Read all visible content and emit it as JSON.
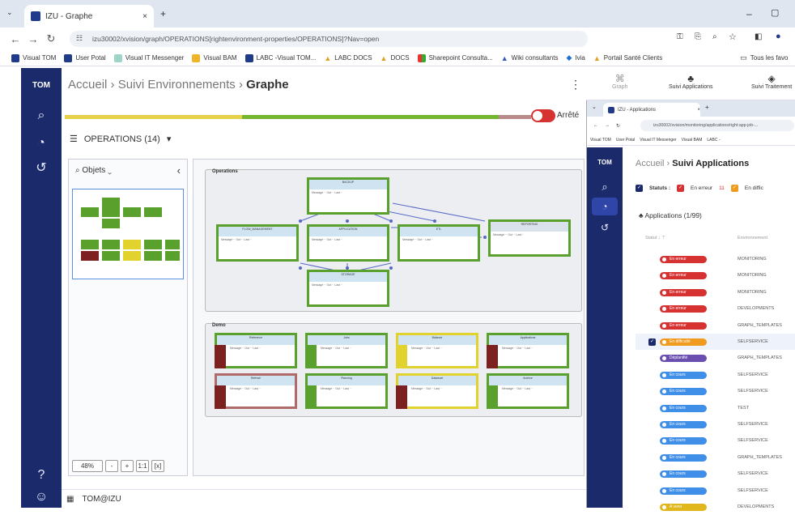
{
  "browser": {
    "tab_title": "IZU - Graphe",
    "tab_close": "×",
    "new_tab": "+",
    "url": "izu30002/xvision/graph/OPERATIONS[rightenvironment-properties/OPERATIONS]?Nav=open",
    "bookmarks": [
      "Visual TOM",
      "User Potal",
      "Visual IT Messenger",
      "Visual BAM",
      "LABC -Visual TOM...",
      "LABC DOCS",
      "DOCS",
      "Sharepoint Consulta...",
      "Wiki consultants",
      "Ivia",
      "Portail Santé Clients",
      "Tous les favo"
    ],
    "window_controls": [
      "–",
      "▢"
    ]
  },
  "app": {
    "logo": "TOM",
    "breadcrumb": {
      "home": "Accueil",
      "mid": "Suivi Environnements",
      "current": "Graphe"
    },
    "kebab": "⋮",
    "toggle_label": "Arrêté",
    "progress": {
      "yellow_fraction": 0.38
    },
    "operations_label": "OPERATIONS (14)",
    "objects_label": "Objets",
    "zoom_value": "48%",
    "zoom_buttons": [
      "-",
      "+",
      "1:1",
      "[x]"
    ],
    "user": "TOM@IZU",
    "group_operations": "Operations",
    "group_demo": "Demo",
    "colors": {
      "sidebar": "#1b2a6b",
      "green": "#5aa02c",
      "brown": "#7c2020",
      "yellow": "#e2d22d",
      "accent": "#74b72e"
    }
  },
  "top_apps": [
    "Graph",
    "Suivi Applications",
    "Suivi Traitement"
  ],
  "app2": {
    "tab_title": "IZU - Applications",
    "url": "izu30002/xvision/monitoring/applications/right:app-job-...",
    "bookmarks": [
      "Visual TOM",
      "User Potal",
      "Visual IT Messenger",
      "Visual BAM",
      "LABC -"
    ],
    "breadcrumb": {
      "home": "Accueil",
      "current": "Suivi Applications"
    },
    "status_label": "Statuts :",
    "status_error": "En erreur",
    "status_error_count": "11",
    "status_difficulty": "En diffic",
    "apps_header": "Applications (1/99)",
    "col_status": "Statut ↓ ⊤",
    "col_env": "Environnement",
    "rows": [
      {
        "status": "En erreur",
        "color": "#d73232",
        "env": "MONITORING"
      },
      {
        "status": "En erreur",
        "color": "#d73232",
        "env": "MONITORING"
      },
      {
        "status": "En erreur",
        "color": "#d73232",
        "env": "MONITORING"
      },
      {
        "status": "En erreur",
        "color": "#d73232",
        "env": "DEVELOPMENTS"
      },
      {
        "status": "En erreur",
        "color": "#d73232",
        "env": "GRAPH_TEMPLATES"
      },
      {
        "status": "En difficulté",
        "color": "#f09a1e",
        "env": "SELFSERVICE"
      },
      {
        "status": "Déplanifié",
        "color": "#6a4fb0",
        "env": "GRAPH_TEMPLATES"
      },
      {
        "status": "En cours",
        "color": "#3f8ee8",
        "env": "SELFSERVICE"
      },
      {
        "status": "En cours",
        "color": "#3f8ee8",
        "env": "SELFSERVICE"
      },
      {
        "status": "En cours",
        "color": "#3f8ee8",
        "env": "TEST"
      },
      {
        "status": "En cours",
        "color": "#3f8ee8",
        "env": "SELFSERVICE"
      },
      {
        "status": "En cours",
        "color": "#3f8ee8",
        "env": "SELFSERVICE"
      },
      {
        "status": "En cours",
        "color": "#3f8ee8",
        "env": "GRAPH_TEMPLATES"
      },
      {
        "status": "En cours",
        "color": "#3f8ee8",
        "env": "SELFSERVICE"
      },
      {
        "status": "En cours",
        "color": "#3f8ee8",
        "env": "SELFSERVICE"
      },
      {
        "status": "A venir",
        "color": "#e0b81e",
        "env": "DEVELOPMENTS"
      }
    ]
  }
}
